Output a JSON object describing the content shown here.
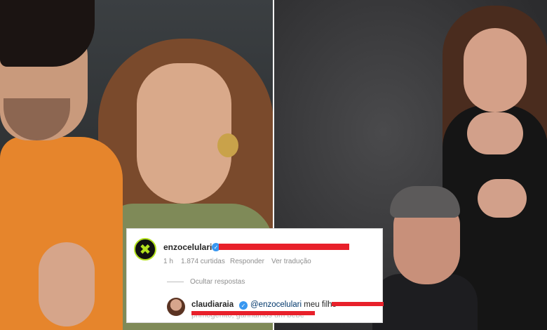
{
  "comment": {
    "user": "enzocelulari",
    "verified_mark": "✓",
    "avatar_glyph": "✖",
    "meta": {
      "time": "1 h",
      "likes": "1.874 curtidas",
      "reply": "Responder",
      "translate": "Ver tradução"
    },
    "hide_replies": "Ocultar respostas"
  },
  "reply": {
    "user": "claudiaraia",
    "verified_mark": "✓",
    "mention": "@enzocelulari",
    "text": "meu filho",
    "line2": "primogênito, ganhamos um bebê"
  },
  "colors": {
    "redaction": "#e8202a",
    "verified": "#3897f0",
    "avatar_ring": "#b3e21e"
  },
  "icons": [
    "verified-badge-icon",
    "avatar-x-logo-icon"
  ]
}
